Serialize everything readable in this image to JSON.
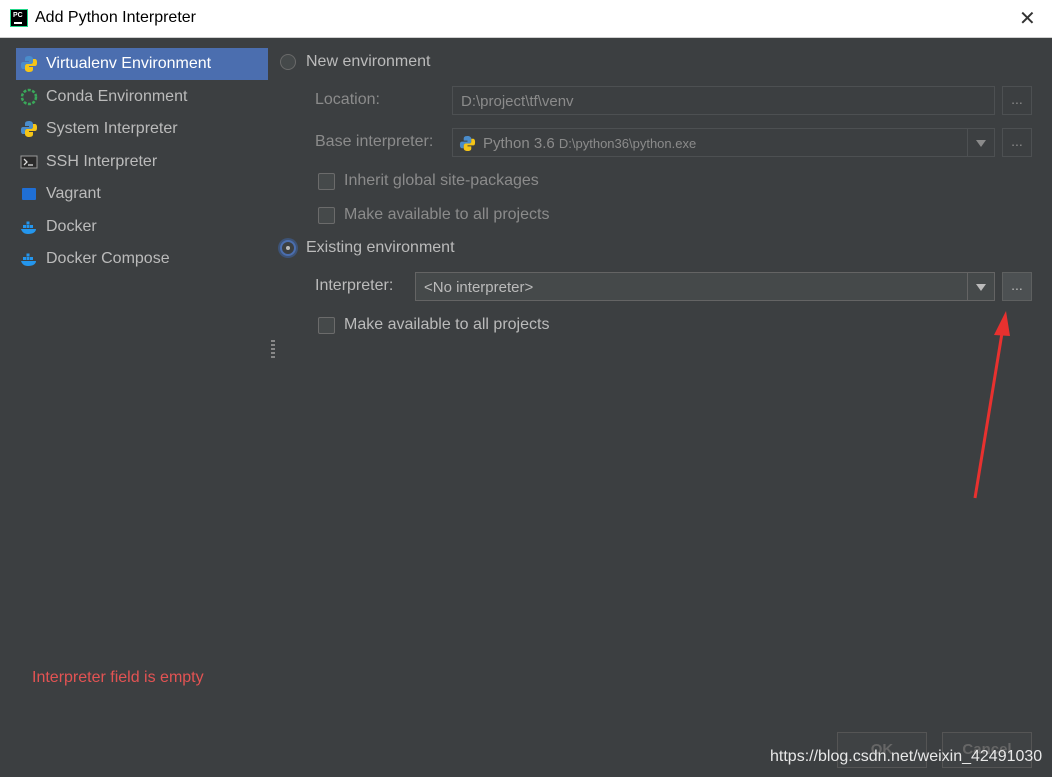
{
  "window": {
    "title": "Add Python Interpreter",
    "close_glyph": "✕"
  },
  "sidebar": {
    "items": [
      {
        "label": "Virtualenv Environment",
        "icon": "python-icon"
      },
      {
        "label": "Conda Environment",
        "icon": "conda-icon"
      },
      {
        "label": "System Interpreter",
        "icon": "python-icon"
      },
      {
        "label": "SSH Interpreter",
        "icon": "terminal-icon"
      },
      {
        "label": "Vagrant",
        "icon": "vagrant-icon"
      },
      {
        "label": "Docker",
        "icon": "docker-icon"
      },
      {
        "label": "Docker Compose",
        "icon": "docker-icon"
      }
    ],
    "selected": "Virtualenv Environment"
  },
  "new_env": {
    "radio_label": "New environment",
    "location_label": "Location:",
    "location_value": "D:\\project\\tf\\venv",
    "base_label": "Base interpreter:",
    "base_name": "Python 3.6",
    "base_path": "D:\\python36\\python.exe",
    "inherit_label": "Inherit global site-packages",
    "make_available_label": "Make available to all projects",
    "browse_label": "..."
  },
  "existing_env": {
    "radio_label": "Existing environment",
    "interpreter_label": "Interpreter:",
    "interpreter_value": "<No interpreter>",
    "make_available_label": "Make available to all projects",
    "browse_label": "..."
  },
  "error": "Interpreter field is empty",
  "footer": {
    "ok_label": "OK",
    "cancel_label": "Cancel"
  },
  "watermark": "https://blog.csdn.net/weixin_42491030",
  "colors": {
    "accent": "#4b6eaf",
    "error": "#e35353",
    "annotation_arrow": "#e8312f",
    "background": "#3c3f41"
  }
}
